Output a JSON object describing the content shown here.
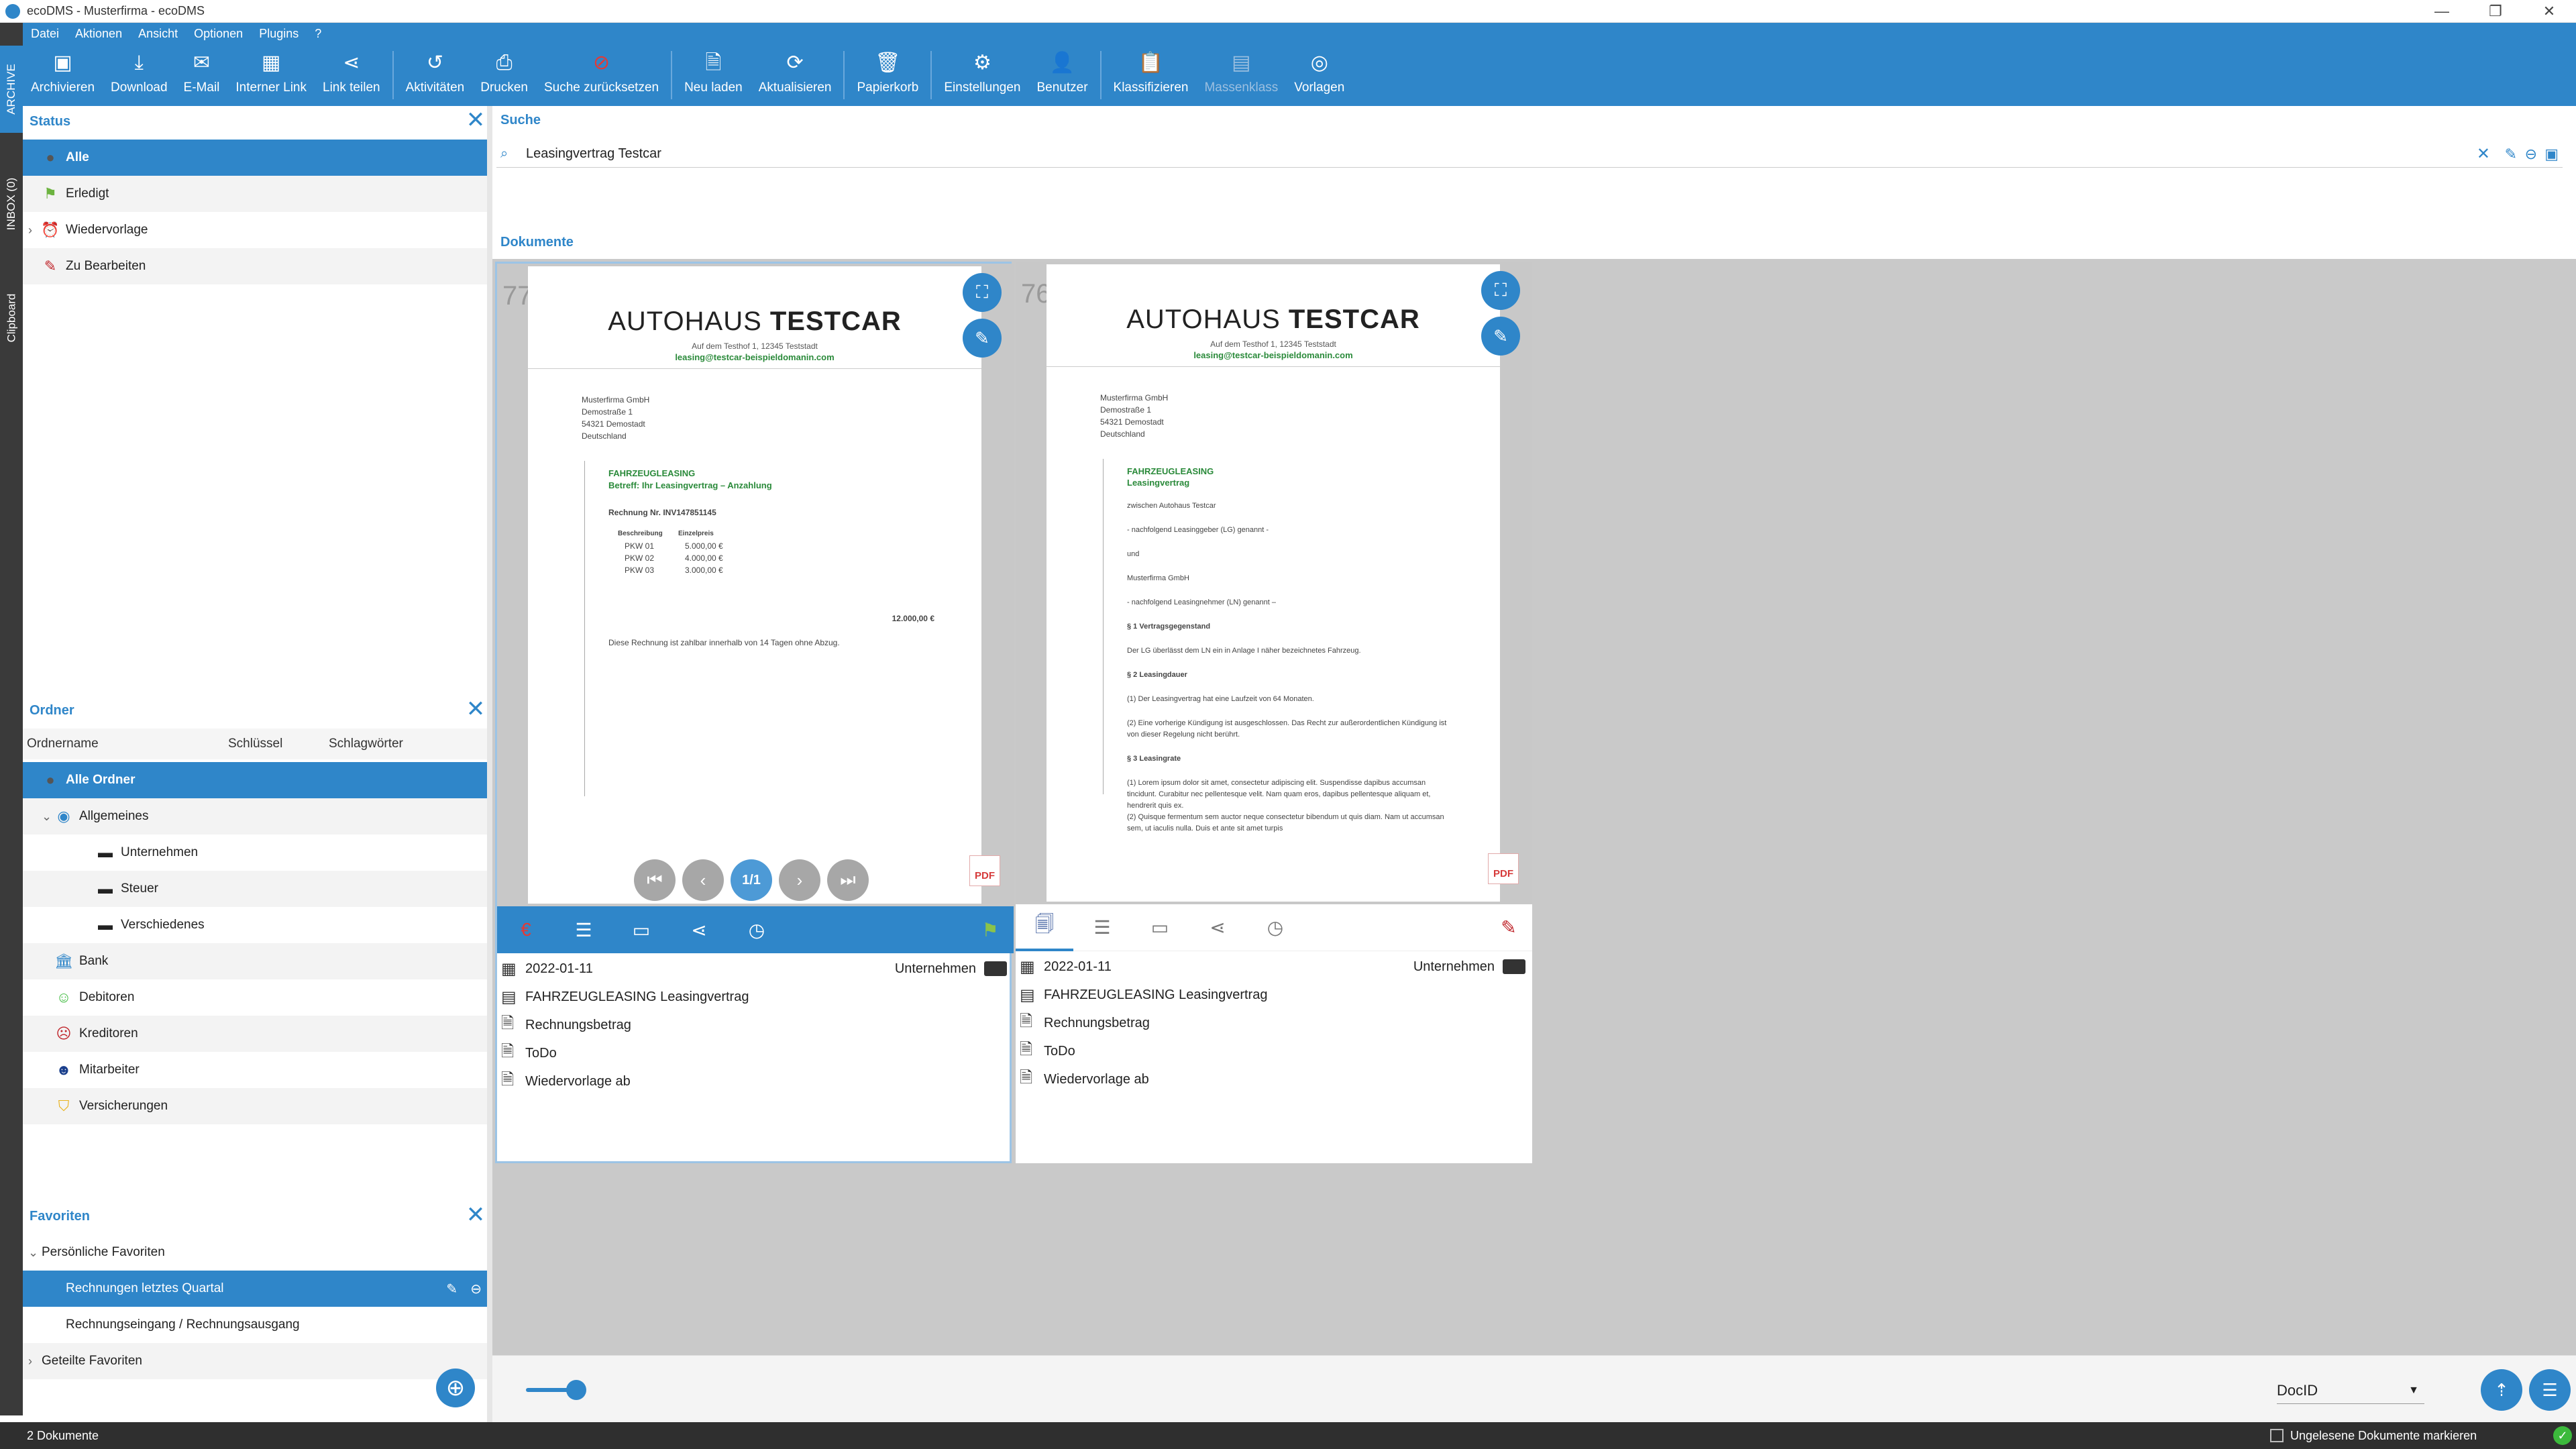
{
  "window": {
    "title": "ecoDMS - Musterfirma - ecoDMS"
  },
  "menu": [
    "Datei",
    "Aktionen",
    "Ansicht",
    "Optionen",
    "Plugins",
    "?"
  ],
  "vtabs": [
    "ARCHIVE",
    "INBOX (0)",
    "Clipboard"
  ],
  "toolbar": {
    "archivieren": "Archivieren",
    "download": "Download",
    "email": "E-Mail",
    "internal_link": "Interner Link",
    "share_link": "Link teilen",
    "activities": "Aktivitäten",
    "print": "Drucken",
    "reset_search": "Suche zurücksetzen",
    "reload": "Neu laden",
    "refresh": "Aktualisieren",
    "trash": "Papierkorb",
    "settings": "Einstellungen",
    "users": "Benutzer",
    "classify": "Klassifizieren",
    "mass_classify": "Massenklass",
    "templates": "Vorlagen"
  },
  "status_panel": {
    "title": "Status",
    "items": [
      "Alle",
      "Erledigt",
      "Wiedervorlage",
      "Zu Bearbeiten"
    ]
  },
  "folder_panel": {
    "title": "Ordner",
    "columns": [
      "Ordnername",
      "Schlüssel",
      "Schlagwörter"
    ],
    "items": [
      "Alle Ordner",
      "Allgemeines",
      "Unternehmen",
      "Steuer",
      "Verschiedenes",
      "Bank",
      "Debitoren",
      "Kreditoren",
      "Mitarbeiter",
      "Versicherungen"
    ]
  },
  "favorites_panel": {
    "title": "Favoriten",
    "items": [
      "Persönliche Favoriten",
      "Rechnungen letztes Quartal",
      "Rechnungseingang / Rechnungsausgang",
      "Geteilte Favoriten"
    ]
  },
  "search": {
    "label": "Suche",
    "value": "Leasingvertrag Testcar"
  },
  "documents_label": "Dokumente",
  "doc1": {
    "id": "77",
    "brand_light": "AUTOHAUS ",
    "brand_bold": "TESTCAR",
    "address": "Auf dem Testhof 1, 12345 Teststadt",
    "email": "leasing@testcar-beispieldomanin.com",
    "recipient": "Musterfirma GmbH\nDemostraße 1\n54321 Demostadt\nDeutschland",
    "heading": "FAHRZEUGLEASING",
    "subject": "Betreff: Ihr Leasingvertrag – Anzahlung",
    "invoice": "Rechnung Nr. INV147851145",
    "col_desc": "Beschreibung",
    "col_price": "Einzelpreis",
    "rows": [
      [
        "PKW 01",
        "5.000,00 €"
      ],
      [
        "PKW 02",
        "4.000,00 €"
      ],
      [
        "PKW 03",
        "3.000,00 €"
      ]
    ],
    "total": "12.000,00 €",
    "footer": "Diese Rechnung ist zahlbar innerhalb von 14 Tagen ohne Abzug.",
    "page": "1/1",
    "pdf": "PDF",
    "meta": {
      "date": "2022-01-11",
      "folder": "Unternehmen",
      "title": "FAHRZEUGLEASING Leasingvertrag",
      "field1": "Rechnungsbetrag",
      "field2": "ToDo",
      "field3": "Wiedervorlage ab"
    }
  },
  "doc2": {
    "id": "76",
    "brand_light": "AUTOHAUS ",
    "brand_bold": "TESTCAR",
    "address": "Auf dem Testhof 1, 12345 Teststadt",
    "email": "leasing@testcar-beispieldomanin.com",
    "recipient": "Musterfirma GmbH\nDemostraße 1\n54321 Demostadt\nDeutschland",
    "heading": "FAHRZEUGLEASING",
    "subheading": "Leasingvertrag",
    "lines": [
      "zwischen Autohaus Testcar",
      "- nachfolgend Leasinggeber (LG) genannt -",
      "und",
      "Musterfirma GmbH",
      "- nachfolgend Leasingnehmer (LN) genannt –",
      "§ 1 Vertragsgegenstand",
      "Der LG überlässt dem LN ein in Anlage I näher bezeichnetes Fahrzeug.",
      "§ 2 Leasingdauer",
      "(1) Der Leasingvertrag hat eine Laufzeit von 64 Monaten.",
      "(2) Eine vorherige Kündigung ist ausgeschlossen. Das Recht zur außerordentlichen Kündigung ist von dieser Regelung nicht berührt.",
      "§ 3 Leasingrate",
      "(1) Lorem ipsum dolor sit amet, consectetur adipiscing elit. Suspendisse dapibus accumsan tincidunt. Curabitur nec pellentesque velit. Nam quam eros, dapibus pellentesque aliquam et, hendrerit quis ex.",
      "(2) Quisque fermentum sem auctor neque consectetur bibendum ut quis diam. Nam ut accumsan sem, ut iaculis nulla. Duis et ante sit amet turpis"
    ],
    "pdf": "PDF",
    "meta": {
      "date": "2022-01-11",
      "folder": "Unternehmen",
      "title": "FAHRZEUGLEASING Leasingvertrag",
      "field1": "Rechnungsbetrag",
      "field2": "ToDo",
      "field3": "Wiedervorlage ab"
    }
  },
  "bottom": {
    "sort": "DocID"
  },
  "statusbar": {
    "count": "2 Dokumente",
    "unread": "Ungelesene Dokumente markieren"
  },
  "colors": {
    "accent": "#2f86c9",
    "status_ok": "#3cba3c",
    "pdf_red": "#d63a3a",
    "brand_green": "#2a8a3a"
  }
}
